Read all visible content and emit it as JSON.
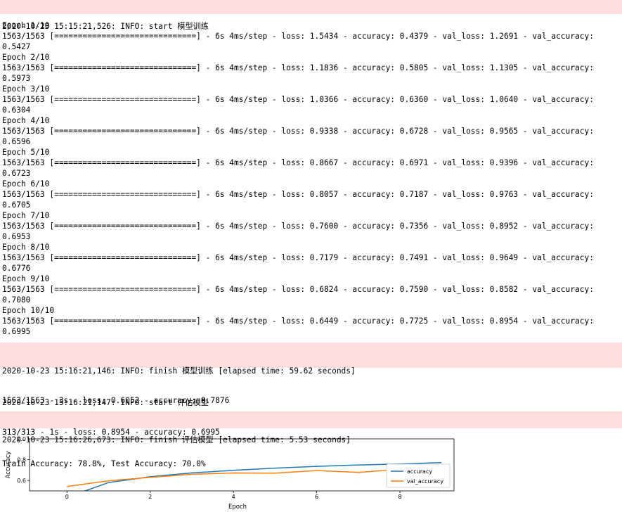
{
  "log1": [
    "2020-10-23 15:15:21,526: INFO: start 模型训练"
  ],
  "epochs": [
    {
      "header": "Epoch 1/10",
      "line": "1563/1563 [==============================] - 6s 4ms/step - loss: 1.5434 - accuracy: 0.4379 - val_loss: 1.2691 - val_accuracy:",
      "wrap": "0.5427"
    },
    {
      "header": "Epoch 2/10",
      "line": "1563/1563 [==============================] - 6s 4ms/step - loss: 1.1836 - accuracy: 0.5805 - val_loss: 1.1305 - val_accuracy:",
      "wrap": "0.5973"
    },
    {
      "header": "Epoch 3/10",
      "line": "1563/1563 [==============================] - 6s 4ms/step - loss: 1.0366 - accuracy: 0.6360 - val_loss: 1.0640 - val_accuracy:",
      "wrap": "0.6304"
    },
    {
      "header": "Epoch 4/10",
      "line": "1563/1563 [==============================] - 6s 4ms/step - loss: 0.9338 - accuracy: 0.6728 - val_loss: 0.9565 - val_accuracy:",
      "wrap": "0.6596"
    },
    {
      "header": "Epoch 5/10",
      "line": "1563/1563 [==============================] - 6s 4ms/step - loss: 0.8667 - accuracy: 0.6971 - val_loss: 0.9396 - val_accuracy:",
      "wrap": "0.6723"
    },
    {
      "header": "Epoch 6/10",
      "line": "1563/1563 [==============================] - 6s 4ms/step - loss: 0.8057 - accuracy: 0.7187 - val_loss: 0.9763 - val_accuracy:",
      "wrap": "0.6705"
    },
    {
      "header": "Epoch 7/10",
      "line": "1563/1563 [==============================] - 6s 4ms/step - loss: 0.7600 - accuracy: 0.7356 - val_loss: 0.8952 - val_accuracy:",
      "wrap": "0.6953"
    },
    {
      "header": "Epoch 8/10",
      "line": "1563/1563 [==============================] - 6s 4ms/step - loss: 0.7179 - accuracy: 0.7491 - val_loss: 0.9649 - val_accuracy:",
      "wrap": "0.6776"
    },
    {
      "header": "Epoch 9/10",
      "line": "1563/1563 [==============================] - 6s 4ms/step - loss: 0.6824 - accuracy: 0.7590 - val_loss: 0.8582 - val_accuracy:",
      "wrap": "0.7080"
    },
    {
      "header": "Epoch 10/10",
      "line": "1563/1563 [==============================] - 6s 4ms/step - loss: 0.6449 - accuracy: 0.7725 - val_loss: 0.8954 - val_accuracy:",
      "wrap": "0.6995"
    }
  ],
  "log2": [
    "2020-10-23 15:16:21,146: INFO: finish 模型训练 [elapsed time: 59.62 seconds]",
    "2020-10-23 15:16:21,147: INFO: start 评估模型"
  ],
  "eval_out": [
    "1563/1563 - 3s - loss: 0.6052 - accuracy: 0.7876",
    "313/313 - 1s - loss: 0.8954 - accuracy: 0.6995",
    "Train Accuracy: 78.8%, Test Accuracy: 70.0%"
  ],
  "log3": [
    "2020-10-23 15:16:26,673: INFO: finish 评估模型 [elapsed time: 5.53 seconds]"
  ],
  "chart_data": {
    "type": "line",
    "xlabel": "Epoch",
    "ylabel": "Accuracy",
    "xlim": [
      -0.9,
      9.3
    ],
    "ylim": [
      0.5,
      1.0
    ],
    "xticks": [
      "0",
      "2",
      "4",
      "6",
      "8"
    ],
    "yticks": [
      "0.6",
      "0.8",
      "1.0"
    ],
    "legend_position": "lower-right",
    "x": [
      0,
      1,
      2,
      3,
      4,
      5,
      6,
      7,
      8,
      9
    ],
    "series": [
      {
        "name": "accuracy",
        "color": "#1f77b4",
        "values": [
          0.4379,
          0.5805,
          0.636,
          0.6728,
          0.6971,
          0.7187,
          0.7356,
          0.7491,
          0.759,
          0.7725
        ]
      },
      {
        "name": "val_accuracy",
        "color": "#ff7f0e",
        "values": [
          0.5427,
          0.5973,
          0.6304,
          0.6596,
          0.6723,
          0.6705,
          0.6953,
          0.6776,
          0.708,
          0.6995
        ]
      }
    ]
  }
}
